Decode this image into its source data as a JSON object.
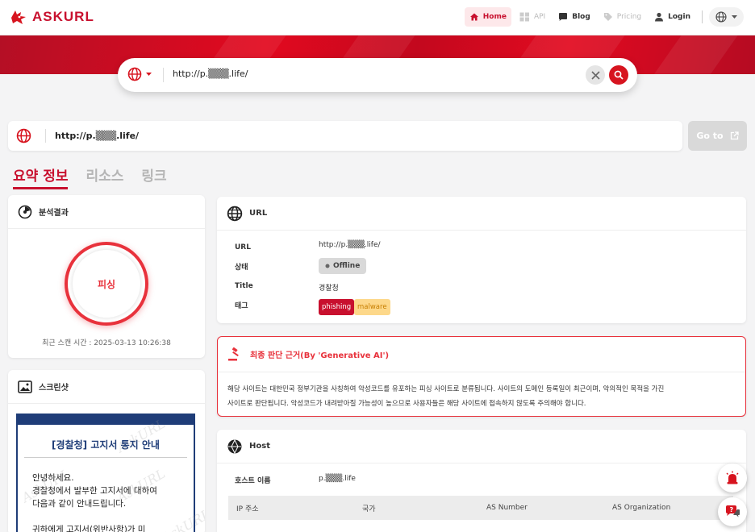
{
  "brand": {
    "name": "ASKURL",
    "accent": "#c8102e"
  },
  "nav": {
    "home": "Home",
    "api": "API",
    "blog": "Blog",
    "pricing": "Pricing",
    "login": "Login"
  },
  "search": {
    "query": "http://p.▒▒▒.life/"
  },
  "target_url": "http://p.▒▒▒.life/",
  "goto_label": "Go to",
  "tabs": [
    "요약 정보",
    "리소스",
    "링크"
  ],
  "analysis": {
    "title": "분석결과",
    "verdict": "피싱",
    "scan_time": "최근 스캔 시간 : 2025-03-13 10:26:38"
  },
  "screenshot": {
    "title": "스크린샷",
    "page_heading": "[경찰청] 고지서 통지 안내",
    "lines": [
      "안녕하세요.",
      "경찰청에서 발부한 고지서에 대하여",
      "다음과 같이 안내드립니다.",
      "귀하에게 고지서(위반사항)가 미"
    ],
    "watermark": "AskURL"
  },
  "url_info": {
    "title": "URL",
    "rows": {
      "url_label": "URL",
      "url_value": "http://p.▒▒▒.life/",
      "status_label": "상태",
      "status_value": "Offline",
      "title_label": "Title",
      "title_value": "경찰청",
      "tag_label": "태그"
    },
    "tags": [
      "phishing",
      "malware"
    ]
  },
  "verdict": {
    "title": "최종 판단 근거(By 'Generative AI')",
    "line1": "해당 사이트는 대한민국 정부기관을 사칭하여 악성코드를 유포하는 피싱 사이트로 분류됩니다. 사이트의 도메인 등록일이 최근이며, 악의적인 목적을 가진",
    "line2": "사이트로 판단됩니다. 악성코드가 내려받아질 가능성이 높으므로 사용자들은 해당 사이트에 접속하지 않도록 주의해야 합니다."
  },
  "host": {
    "title": "Host",
    "hostname_label": "호스트 이름",
    "hostname_value": "p.▒▒▒.life",
    "columns": [
      "IP 주소",
      "국가",
      "AS Number",
      "AS Organization"
    ]
  }
}
